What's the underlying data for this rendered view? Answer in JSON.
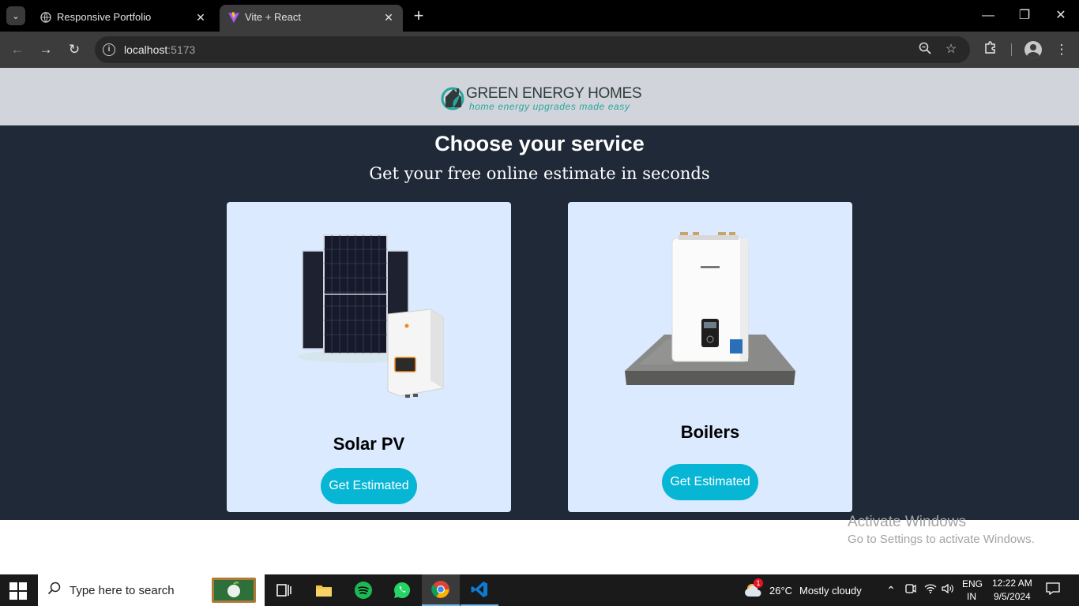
{
  "browser": {
    "tabs": [
      {
        "title": "Responsive Portfolio",
        "active": false
      },
      {
        "title": "Vite + React",
        "active": true
      }
    ],
    "url_host": "localhost",
    "url_port": ":5173"
  },
  "site": {
    "logo_title": "GREEN ENERGY HOMES",
    "logo_tagline": "home energy upgrades made easy",
    "heading": "Choose your service",
    "subheading": "Get your free online estimate in seconds",
    "cards": [
      {
        "label": "Solar PV",
        "button": "Get Estimated",
        "image": "solar-panel-with-inverter"
      },
      {
        "label": "Boilers",
        "button": "Get Estimated",
        "image": "boiler-on-stone-slab"
      }
    ],
    "colors": {
      "header_bg": "#d1d5db",
      "main_bg": "#1f2937",
      "card_bg": "#dbeafe",
      "button_bg": "#06b6d4"
    }
  },
  "watermark": {
    "line1": "Activate Windows",
    "line2": "Go to Settings to activate Windows."
  },
  "taskbar": {
    "search_placeholder": "Type here to search",
    "weather_temp": "26°C",
    "weather_desc": "Mostly cloudy",
    "weather_badge": "1",
    "lang_top": "ENG",
    "lang_bottom": "IN",
    "time": "12:22 AM",
    "date": "9/5/2024",
    "apps": [
      "task-view",
      "file-explorer",
      "spotify",
      "whatsapp",
      "chrome",
      "vscode"
    ]
  }
}
